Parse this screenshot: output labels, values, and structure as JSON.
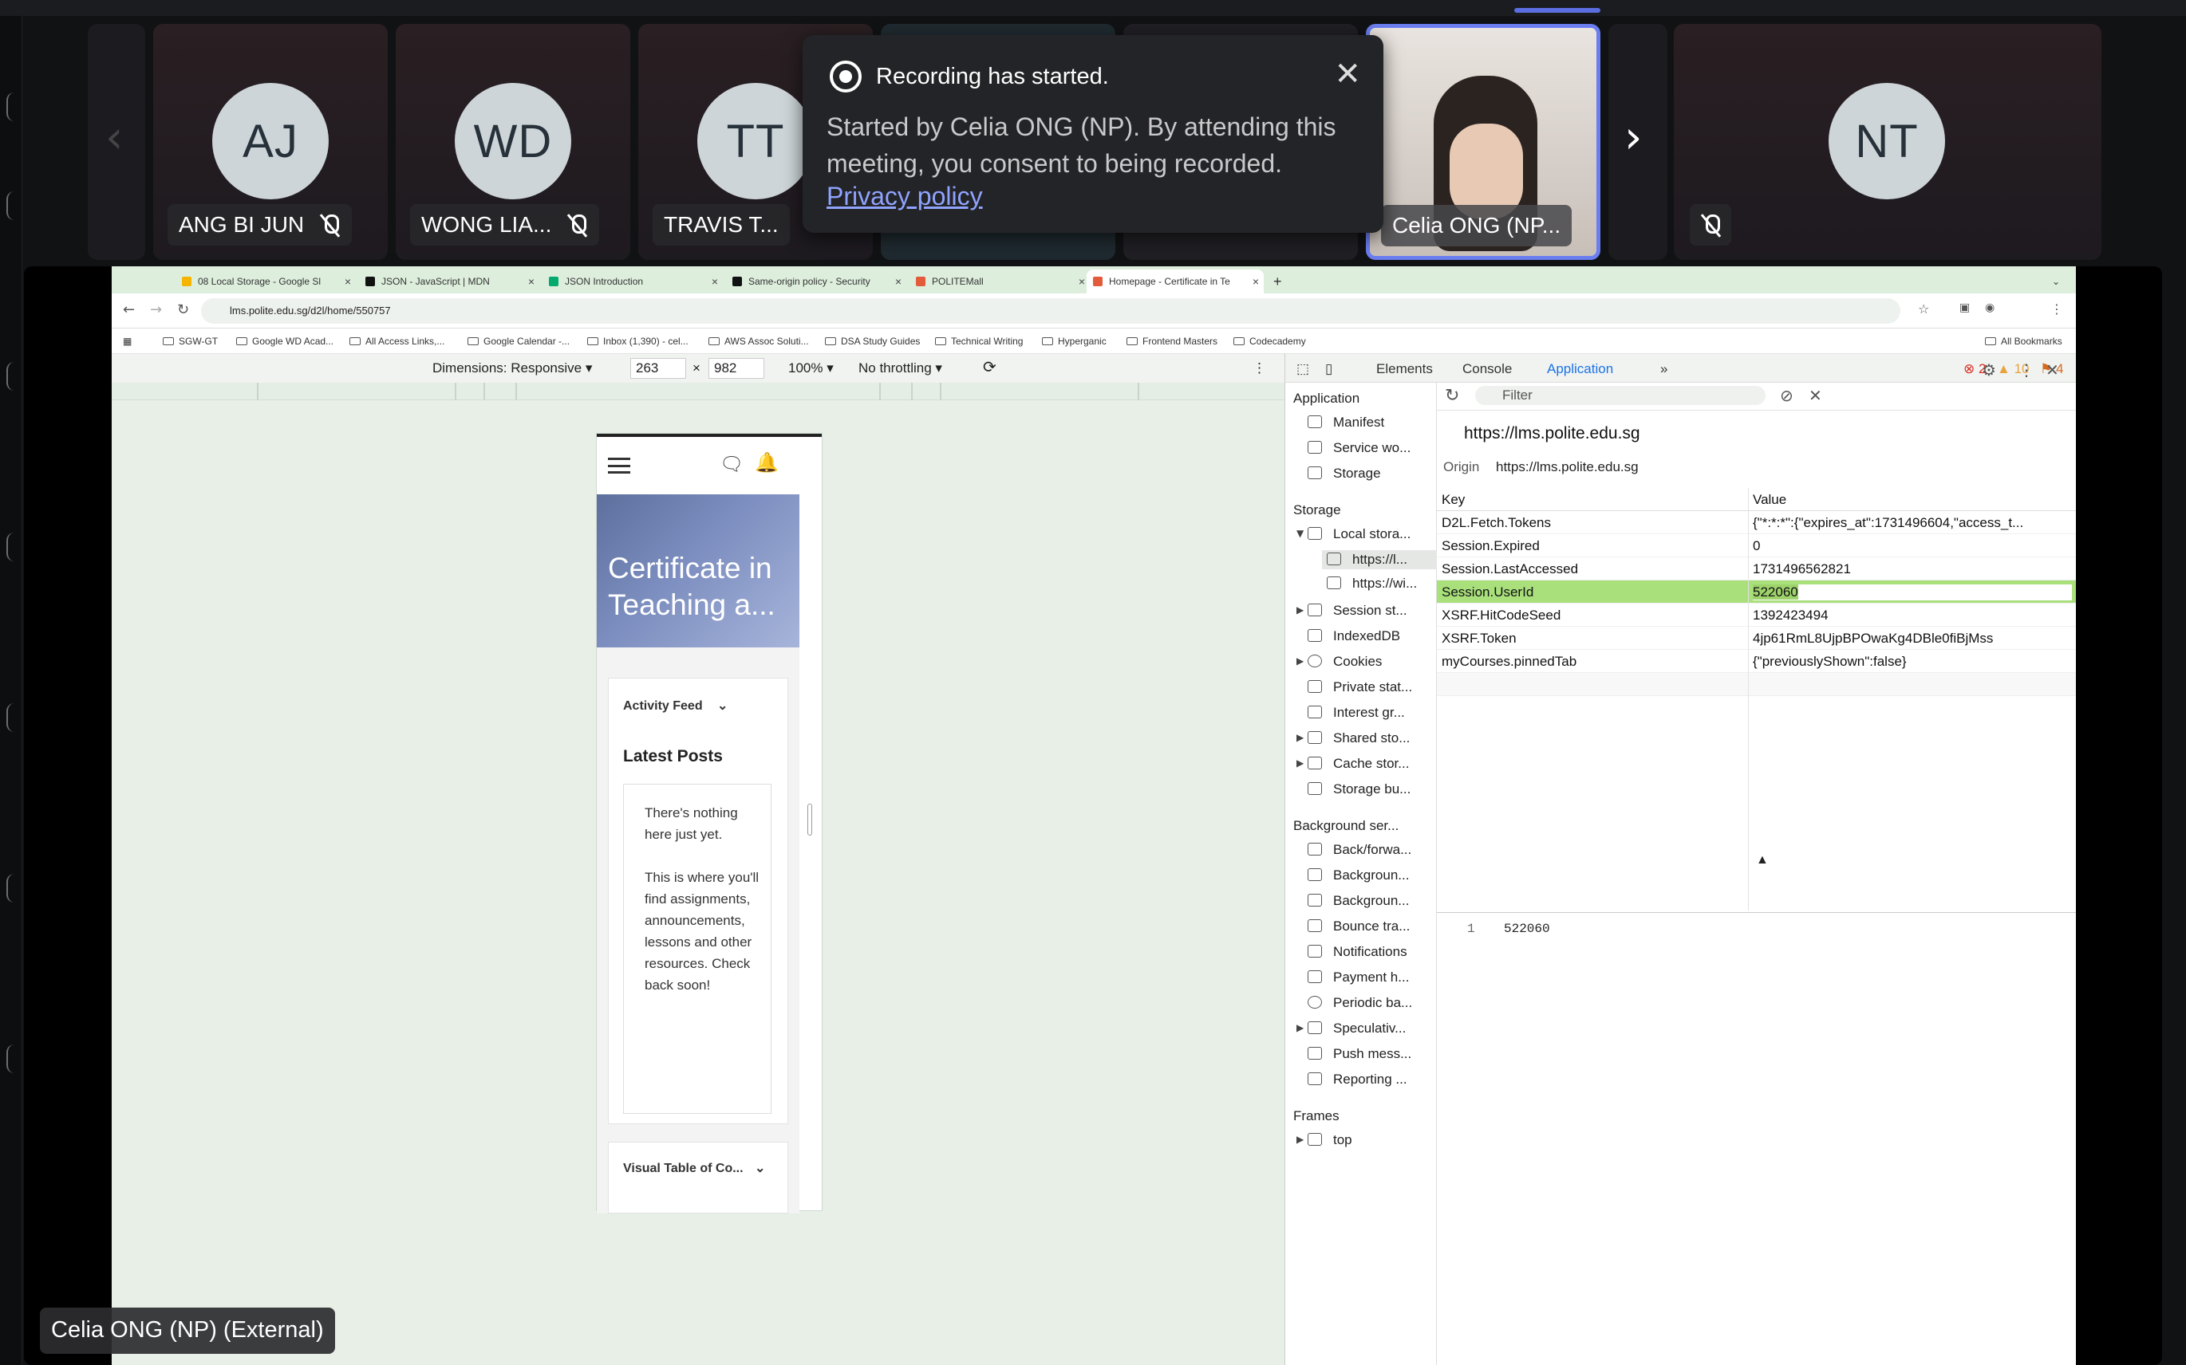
{
  "participants": [
    {
      "initials": "AJ",
      "name": "ANG BI JUN",
      "muted": true
    },
    {
      "initials": "WD",
      "name": "WONG LIA...",
      "muted": true
    },
    {
      "initials": "TT",
      "name": "TRAVIS T...",
      "muted": true
    },
    {
      "initials": "NT",
      "name": "",
      "muted": true
    }
  ],
  "active_speaker": {
    "name": "Celia ONG (NP..."
  },
  "toast": {
    "title": "Recording has started.",
    "body": "Started by Celia ONG (NP). By attending this meeting, you consent to being recorded.",
    "link": "Privacy policy"
  },
  "presenter_label": "Celia ONG (NP) (External)",
  "browser": {
    "tabs": [
      {
        "label": "08 Local Storage - Google Sl",
        "color": "#f4b400"
      },
      {
        "label": "JSON - JavaScript | MDN",
        "color": "#111111"
      },
      {
        "label": "JSON Introduction",
        "color": "#04aa6d"
      },
      {
        "label": "Same-origin policy - Security",
        "color": "#111111"
      },
      {
        "label": "POLITEMall",
        "color": "#e25b3a"
      },
      {
        "label": "Homepage - Certificate in Te",
        "color": "#e25b3a"
      }
    ],
    "url": "lms.polite.edu.sg/d2l/home/550757",
    "bookmarks": [
      "SGW-GT",
      "Google WD Acad...",
      "All Access Links,...",
      "Google Calendar -...",
      "Inbox (1,390) - cel...",
      "AWS Assoc Soluti...",
      "DSA Study Guides",
      "Technical Writing",
      "Hyperganic",
      "Frontend Masters",
      "Codecademy"
    ],
    "all_bookmarks": "All Bookmarks"
  },
  "device_toolbar": {
    "dimensions": "Dimensions: Responsive",
    "width": "263",
    "height": "982",
    "zoom": "100%",
    "throttle": "No throttling"
  },
  "mobile_page": {
    "hero_title": "Certificate in Teaching a...",
    "activity_feed": "Activity Feed",
    "latest_posts": "Latest Posts",
    "empty_text_1": "There's nothing here just yet.",
    "empty_text_2": "This is where you'll find assignments, announcements, lessons and other resources. Check back soon!",
    "visual_toc": "Visual Table of Co..."
  },
  "devtools": {
    "tabs": [
      "Elements",
      "Console",
      "Application"
    ],
    "errors": "2",
    "warnings": "10",
    "issues": "4",
    "filter_placeholder": "Filter",
    "origin_url": "https://lms.polite.edu.sg",
    "origin_label": "Origin",
    "origin_value": "https://lms.polite.edu.sg",
    "col_key": "Key",
    "col_value": "Value",
    "rows": [
      {
        "key": "D2L.Fetch.Tokens",
        "value": "{\"*:*:*\":{\"expires_at\":1731496604,\"access_t..."
      },
      {
        "key": "Session.Expired",
        "value": "0"
      },
      {
        "key": "Session.LastAccessed",
        "value": "1731496562821"
      },
      {
        "key": "Session.UserId",
        "value": "522060"
      },
      {
        "key": "XSRF.HitCodeSeed",
        "value": "1392423494"
      },
      {
        "key": "XSRF.Token",
        "value": "4jp61RmL8UjpBPOwaKg4DBle0fiBjMss"
      },
      {
        "key": "myCourses.pinnedTab",
        "value": "{\"previouslyShown\":false}"
      }
    ],
    "preview_line": "1",
    "preview_value": "522060",
    "sidebar": {
      "application": "Application",
      "manifest": "Manifest",
      "service_workers": "Service wo...",
      "storage": "Storage",
      "storage_h": "Storage",
      "local_storage": "Local stora...",
      "ls_1": "https://l...",
      "ls_2": "https://wi...",
      "session_storage": "Session st...",
      "indexeddb": "IndexedDB",
      "cookies": "Cookies",
      "private_state": "Private stat...",
      "interest_groups": "Interest gr...",
      "shared_storage": "Shared sto...",
      "cache_storage": "Cache stor...",
      "storage_buckets": "Storage bu...",
      "background_h": "Background ser...",
      "bfcache": "Back/forwa...",
      "bg_fetch": "Backgroun...",
      "bg_sync": "Backgroun...",
      "bounce": "Bounce tra...",
      "notifications": "Notifications",
      "payment": "Payment h...",
      "periodic": "Periodic ba...",
      "speculative": "Speculativ...",
      "push": "Push mess...",
      "reporting": "Reporting ...",
      "frames_h": "Frames",
      "top": "top"
    }
  }
}
